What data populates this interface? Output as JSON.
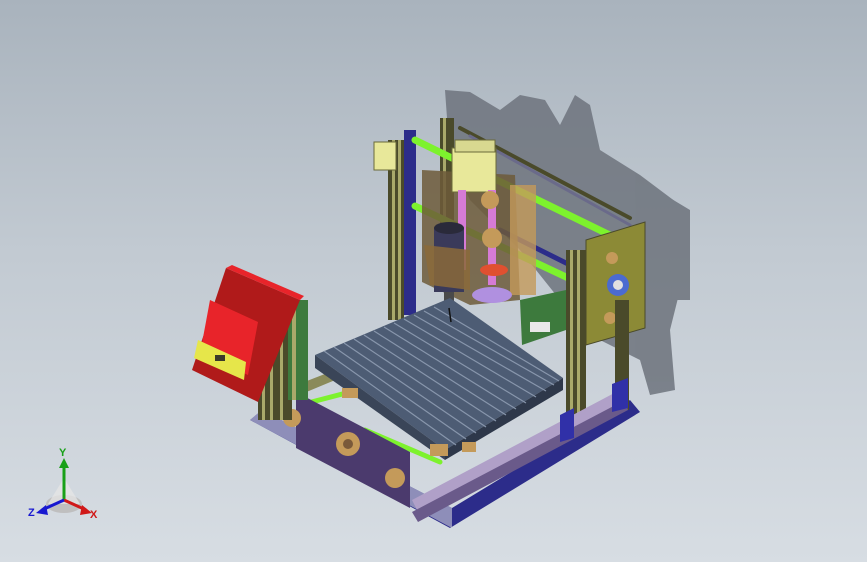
{
  "viewport": {
    "background_top": "#a9b3bd",
    "background_bottom": "#d7dde3"
  },
  "model": {
    "colors": {
      "frame_olive": "#a9a96a",
      "frame_dark": "#4a4a2a",
      "plate_purple": "#4b3a6d",
      "plate_blue": "#2c2c8a",
      "rod_green": "#7df22d",
      "bed_slate": "#5e6f86",
      "motor_cream": "#e8e89a",
      "spindle_pink": "#d67bd6",
      "bearing_tan": "#c49a5a",
      "panel_red": "#e8242a",
      "panel_yellow": "#e6e64a",
      "bracket_blue": "#3030a8",
      "board_green": "#3d7a3d",
      "shadow": "#6d737c"
    }
  },
  "triad": {
    "x_label": "X",
    "y_label": "Y",
    "z_label": "Z",
    "x_color": "#d01818",
    "y_color": "#18a018",
    "z_color": "#1818d0"
  }
}
